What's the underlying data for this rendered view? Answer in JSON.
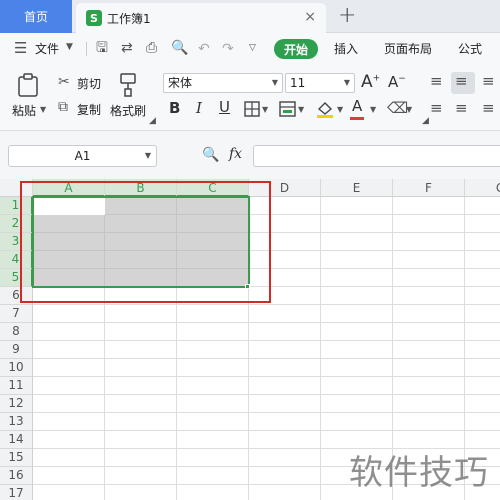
{
  "tabs": {
    "home": "首页",
    "doc_icon": "S",
    "doc": "工作簿1",
    "close": "×",
    "add": "+"
  },
  "menu": {
    "file": "文件",
    "start": "开始",
    "insert": "插入",
    "layout": "页面布局",
    "formula": "公式"
  },
  "ribbon": {
    "paste": "粘贴",
    "cut": "剪切",
    "copy": "复制",
    "format_painter": "格式刷",
    "font": "宋体",
    "font_size": "11",
    "bold": "B",
    "italic": "I",
    "underline": "U",
    "font_color_letter": "A",
    "font_color": "#e03b3b",
    "fill_color": "#f4d000"
  },
  "formula_bar": {
    "name_box": "A1",
    "fx": "fx"
  },
  "sheet": {
    "columns": [
      "A",
      "B",
      "C",
      "D",
      "E",
      "F",
      "G"
    ],
    "rows": [
      "1",
      "2",
      "3",
      "4",
      "5",
      "6",
      "7",
      "8",
      "9",
      "10",
      "11",
      "12",
      "13",
      "14",
      "15",
      "16",
      "17"
    ],
    "selected_range": "A1:C5",
    "accent": "#3a9a4f",
    "annotation_color": "#d32929"
  },
  "watermark": "软件技巧"
}
